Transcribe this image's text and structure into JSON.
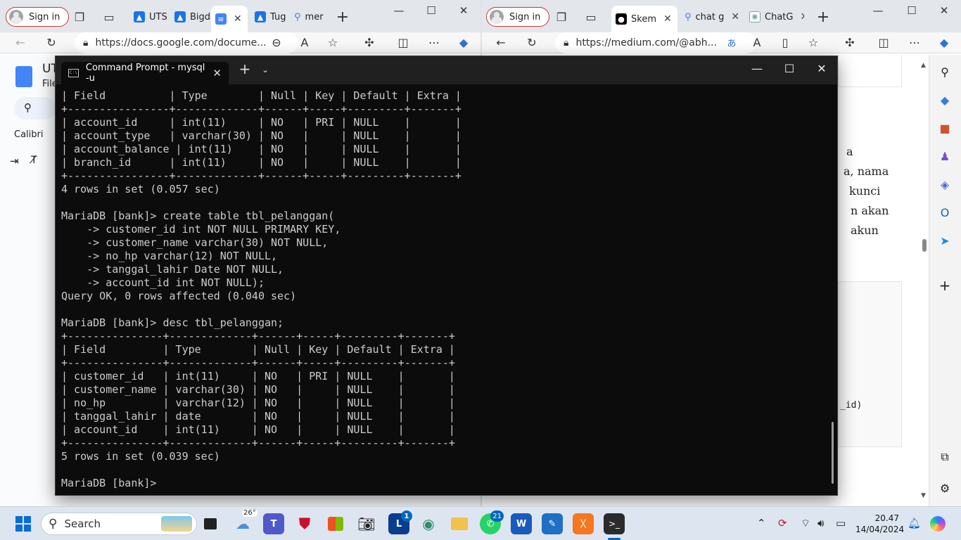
{
  "browser_left": {
    "sign_in": "Sign in",
    "tabs": [
      {
        "title": "UTS",
        "color": "#1a73e8"
      },
      {
        "title": "Bigd",
        "color": "#1a73e8"
      },
      {
        "title": "",
        "color": "#4285f4"
      },
      {
        "title": "Tug",
        "color": "#1a73e8"
      },
      {
        "title": "mer",
        "color": "#3c7ff0"
      }
    ],
    "url": "https://docs.google.com/docume...",
    "doc_title": "UT",
    "doc_menu": "File",
    "font_name": "Calibri"
  },
  "browser_right": {
    "sign_in": "Sign in",
    "tabs": [
      {
        "title": "Skem"
      },
      {
        "title": "chat g"
      },
      {
        "title": "ChatG"
      }
    ],
    "url": "https://medium.com/@abh...",
    "article_fragments": [
      "a",
      "a, nama",
      "kunci",
      "n akan",
      "akun"
    ],
    "code_fragment": "_id)"
  },
  "cmd": {
    "tab_title": "Command Prompt - mysql  -u",
    "lines": [
      "| Field          | Type        | Null | Key | Default | Extra |",
      "+----------------+-------------+------+-----+---------+-------+",
      "| account_id     | int(11)     | NO   | PRI | NULL    |       |",
      "| account_type   | varchar(30) | NO   |     | NULL    |       |",
      "| account_balance | int(11)    | NO   |     | NULL    |       |",
      "| branch_id      | int(11)     | NO   |     | NULL    |       |",
      "+----------------+-------------+------+-----+---------+-------+",
      "4 rows in set (0.057 sec)",
      "",
      "MariaDB [bank]> create table tbl_pelanggan(",
      "    -> customer_id int NOT NULL PRIMARY KEY,",
      "    -> customer_name varchar(30) NOT NULL,",
      "    -> no_hp varchar(12) NOT NULL,",
      "    -> tanggal_lahir Date NOT NULL,",
      "    -> account_id int NOT NULL);",
      "Query OK, 0 rows affected (0.040 sec)",
      "",
      "MariaDB [bank]> desc tbl_pelanggan;",
      "+---------------+-------------+------+-----+---------+-------+",
      "| Field         | Type        | Null | Key | Default | Extra |",
      "+---------------+-------------+------+-----+---------+-------+",
      "| customer_id   | int(11)     | NO   | PRI | NULL    |       |",
      "| customer_name | varchar(30) | NO   |     | NULL    |       |",
      "| no_hp         | varchar(12) | NO   |     | NULL    |       |",
      "| tanggal_lahir | date        | NO   |     | NULL    |       |",
      "| account_id    | int(11)     | NO   |     | NULL    |       |",
      "+---------------+-------------+------+-----+---------+-------+",
      "5 rows in set (0.039 sec)",
      "",
      "MariaDB [bank]> "
    ]
  },
  "taskbar": {
    "search_label": "Search",
    "weather_temp": "26°",
    "badges": {
      "outlook": "1",
      "whatsapp": "21"
    },
    "time": "20.47",
    "date": "14/04/2024"
  }
}
